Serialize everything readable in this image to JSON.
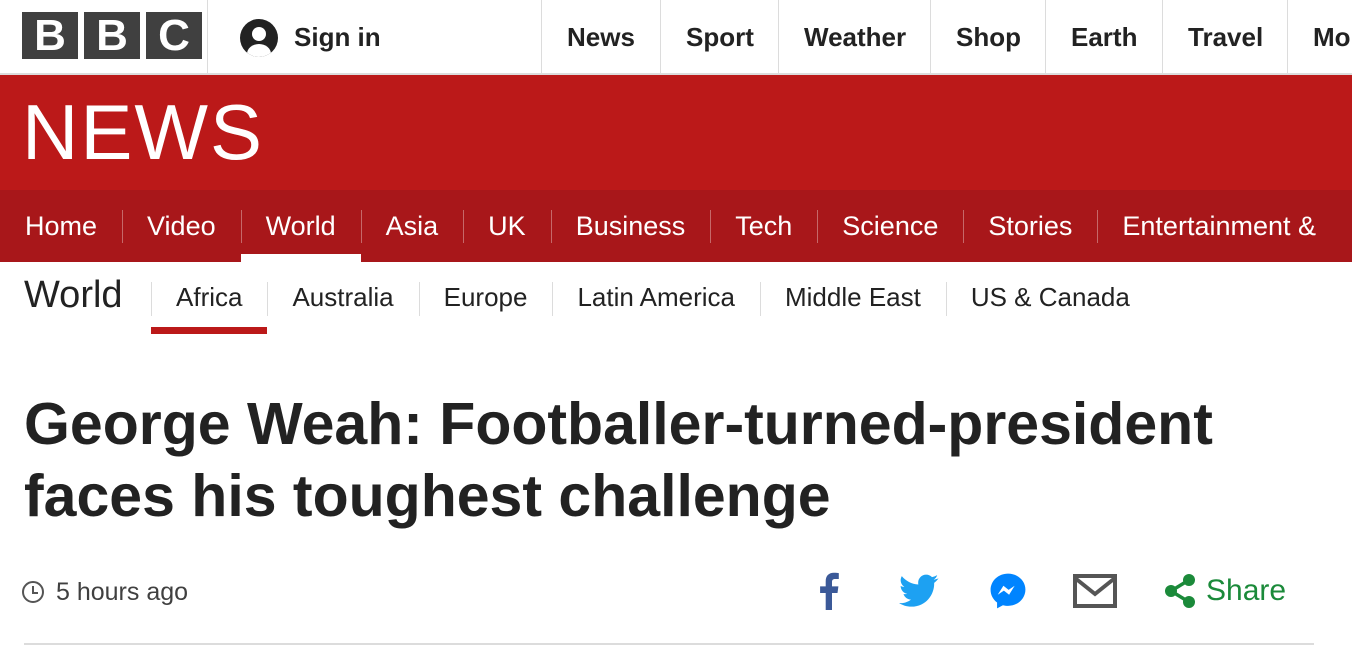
{
  "header": {
    "logo_letters": [
      "B",
      "B",
      "C"
    ],
    "signin_label": "Sign in",
    "nav": [
      "News",
      "Sport",
      "Weather",
      "Shop",
      "Earth",
      "Travel",
      "Mor"
    ]
  },
  "banner": {
    "title": "NEWS"
  },
  "main_nav": {
    "items": [
      "Home",
      "Video",
      "World",
      "Asia",
      "UK",
      "Business",
      "Tech",
      "Science",
      "Stories",
      "Entertainment &"
    ],
    "active": "World"
  },
  "sub_nav": {
    "section_title": "World",
    "items": [
      "Africa",
      "Australia",
      "Europe",
      "Latin America",
      "Middle East",
      "US & Canada"
    ],
    "active": "Africa"
  },
  "article": {
    "headline": "George Weah: Footballer-turned-president faces his toughest challenge",
    "timestamp": "5 hours ago"
  },
  "share": {
    "label": "Share",
    "icons": [
      "facebook-icon",
      "twitter-icon",
      "messenger-icon",
      "email-icon",
      "share-icon"
    ]
  },
  "colors": {
    "brand_red": "#bb1919",
    "nav_red": "#a8171a",
    "facebook": "#3b5998",
    "twitter": "#1da1f2",
    "messenger": "#0084ff",
    "share_green": "#1b8a3a"
  }
}
